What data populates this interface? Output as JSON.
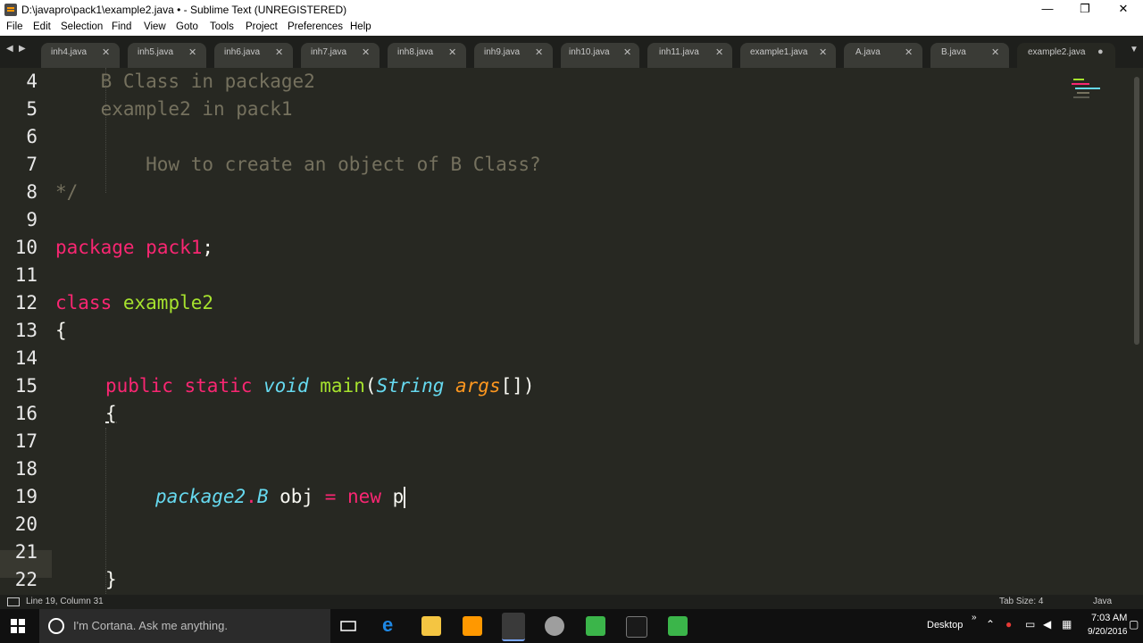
{
  "window": {
    "title": "D:\\javapro\\pack1\\example2.java • - Sublime Text (UNREGISTERED)",
    "minimize": "—",
    "maximize": "❐",
    "close": "✕"
  },
  "menu": [
    "File",
    "Edit",
    "Selection",
    "Find",
    "View",
    "Goto",
    "Tools",
    "Project",
    "Preferences",
    "Help"
  ],
  "tabs": [
    {
      "label": "inh4.java",
      "close": "✕"
    },
    {
      "label": "inh5.java",
      "close": "✕"
    },
    {
      "label": "inh6.java",
      "close": "✕"
    },
    {
      "label": "inh7.java",
      "close": "✕"
    },
    {
      "label": "inh8.java",
      "close": "✕"
    },
    {
      "label": "inh9.java",
      "close": "✕"
    },
    {
      "label": "inh10.java",
      "close": "✕"
    },
    {
      "label": "inh11.java",
      "close": "✕"
    },
    {
      "label": "example1.java",
      "close": "✕"
    },
    {
      "label": "A.java",
      "close": "✕"
    },
    {
      "label": "B.java",
      "close": "✕"
    },
    {
      "label": "example2.java",
      "close": "●"
    }
  ],
  "nav": {
    "left": "◀",
    "right": "▶",
    "overflow": "▼"
  },
  "line_numbers": [
    "4",
    "5",
    "6",
    "7",
    "8",
    "9",
    "10",
    "11",
    "12",
    "13",
    "14",
    "15",
    "16",
    "17",
    "18",
    "19",
    "20",
    "21",
    "22"
  ],
  "code": {
    "l4": "    B Class in package2",
    "l5": "    example2 in pack1",
    "l7": "        How to create an object of B Class?",
    "l8": "*/",
    "l10_kw": "package",
    "l10_name": "pack1",
    "l10_semi": ";",
    "l12_kw": "class",
    "l12_name": "example2",
    "l13": "{",
    "l15_public": "public",
    "l15_static": "static",
    "l15_void": "void",
    "l15_main": "main",
    "l15_open": "(",
    "l15_string": "String",
    "l15_args": "args",
    "l15_close": "[])",
    "l16": "{",
    "l19_pkg": "package2",
    "l19_dot": ".",
    "l19_b": "B",
    "l19_obj": "obj",
    "l19_eq": "=",
    "l19_new": "new",
    "l19_p": "p",
    "l22": "}"
  },
  "status": {
    "position": "Line 19, Column 31",
    "tab_size": "Tab Size: 4",
    "syntax": "Java"
  },
  "taskbar": {
    "cortana": "I'm Cortana. Ask me anything.",
    "desktop": "Desktop",
    "time": "7:03 AM",
    "date": "9/20/2016"
  },
  "colors": {
    "bg": "#272822",
    "keyword": "#f92672",
    "class": "#a6e22e",
    "type": "#66d9ef",
    "arg": "#fd971f",
    "comment": "#75715e"
  }
}
